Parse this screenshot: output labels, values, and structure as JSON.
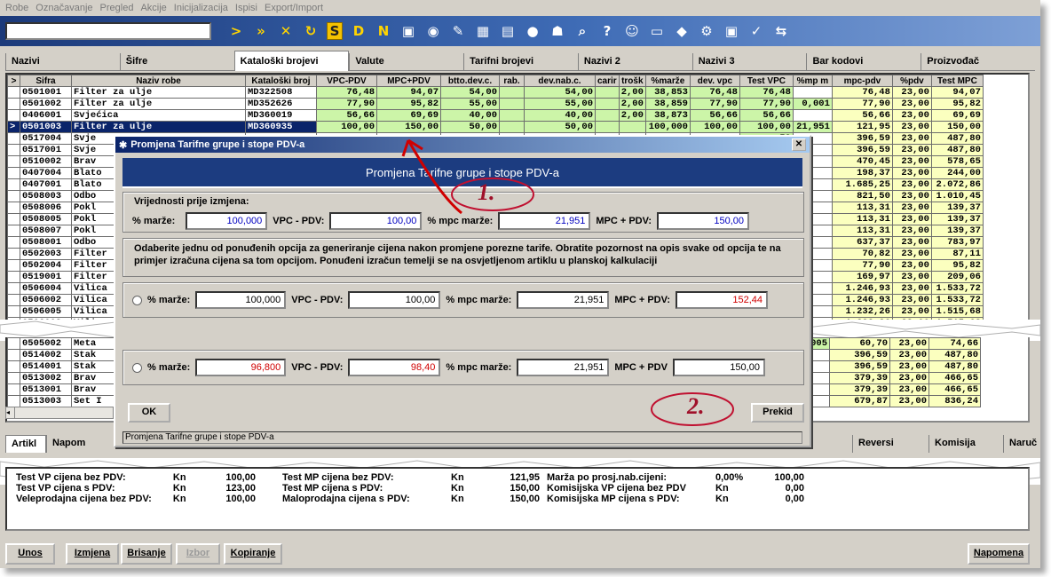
{
  "menu": [
    "Robe",
    "Označavanje",
    "Pregled",
    "Akcije",
    "Inicijalizacija",
    "Ispisi",
    "Export/Import"
  ],
  "toolbar_icons": [
    ">",
    "»",
    "✕",
    "↻",
    "S",
    "D",
    "N",
    "▣",
    "◉",
    "✎",
    "▦",
    "▤",
    "●",
    "☗",
    "⌕",
    "?",
    "☺",
    "▭",
    "◆",
    "⚙",
    "▣",
    "✓",
    "⇆"
  ],
  "tabs": [
    "Nazivi",
    "Šifre",
    "Kataloški brojevi",
    "Valute",
    "Tarifni brojevi",
    "Nazivi 2",
    "Nazivi 3",
    "Bar kodovi",
    "Proizvođač"
  ],
  "grid": {
    "headers": [
      ">",
      "Sifra",
      "Naziv robe",
      "Kataloški broj",
      "VPC-PDV",
      "MPC+PDV",
      "btto.dev.c.",
      "rab.",
      "dev.nab.c.",
      "carir",
      "trošk",
      "%marže",
      "dev. vpc",
      "Test VPC",
      "%mp m",
      "mpc-pdv",
      "%pdv",
      "Test MPC"
    ],
    "rows": [
      [
        "",
        "0501001",
        "Filter za ulje",
        "MD322508",
        "76,48",
        "94,07",
        "54,00",
        "",
        "54,00",
        "",
        "2,00",
        "38,853",
        "76,48",
        "76,48",
        "",
        "76,48",
        "23,00",
        "94,07"
      ],
      [
        "",
        "0501002",
        "Filter za ulje",
        "MD352626",
        "77,90",
        "95,82",
        "55,00",
        "",
        "55,00",
        "",
        "2,00",
        "38,859",
        "77,90",
        "77,90",
        "0,001",
        "77,90",
        "23,00",
        "95,82"
      ],
      [
        "",
        "0406001",
        "Svjećica",
        "MD360019",
        "56,66",
        "69,69",
        "40,00",
        "",
        "40,00",
        "",
        "2,00",
        "38,873",
        "56,66",
        "56,66",
        "",
        "56,66",
        "23,00",
        "69,69"
      ],
      [
        ">",
        "0501003",
        "Filter za ulje",
        "MD360935",
        "100,00",
        "150,00",
        "50,00",
        "",
        "50,00",
        "",
        "",
        "100,000",
        "100,00",
        "100,00",
        "21,951",
        "121,95",
        "23,00",
        "150,00"
      ],
      [
        "",
        "0517004",
        "Svje",
        "",
        "",
        "",
        "",
        "",
        "",
        "",
        "",
        "",
        "",
        "59",
        "",
        "396,59",
        "23,00",
        "487,80"
      ],
      [
        "",
        "0517001",
        "Svje",
        "",
        "",
        "",
        "",
        "",
        "",
        "",
        "",
        "",
        "",
        "59",
        "",
        "396,59",
        "23,00",
        "487,80"
      ],
      [
        "",
        "0510002",
        "Brav",
        "",
        "",
        "",
        "",
        "",
        "",
        "",
        "",
        "",
        "",
        "45",
        "",
        "470,45",
        "23,00",
        "578,65"
      ],
      [
        "",
        "0407004",
        "Blato",
        "",
        "",
        "",
        "",
        "",
        "",
        "",
        "",
        "",
        "",
        "37",
        "",
        "198,37",
        "23,00",
        "244,00"
      ],
      [
        "",
        "0407001",
        "Blato",
        "",
        "",
        "",
        "",
        "",
        "",
        "",
        "",
        "",
        "",
        "25",
        "",
        "1.685,25",
        "23,00",
        "2.072,86"
      ],
      [
        "",
        "0508003",
        "Odbo",
        "",
        "",
        "",
        "",
        "",
        "",
        "",
        "",
        "",
        "",
        "50",
        "",
        "821,50",
        "23,00",
        "1.010,45"
      ],
      [
        "",
        "0508006",
        "Pokl",
        "",
        "",
        "",
        "",
        "",
        "",
        "",
        "",
        "",
        "",
        "31",
        "",
        "113,31",
        "23,00",
        "139,37"
      ],
      [
        "",
        "0508005",
        "Pokl",
        "",
        "",
        "",
        "",
        "",
        "",
        "",
        "",
        "",
        "",
        "31",
        "",
        "113,31",
        "23,00",
        "139,37"
      ],
      [
        "",
        "0508007",
        "Pokl",
        "",
        "",
        "",
        "",
        "",
        "",
        "",
        "",
        "",
        "",
        "31",
        "",
        "113,31",
        "23,00",
        "139,37"
      ],
      [
        "",
        "0508001",
        "Odbo",
        "",
        "",
        "",
        "",
        "",
        "",
        "",
        "",
        "",
        "",
        "37",
        "",
        "637,37",
        "23,00",
        "783,97"
      ],
      [
        "",
        "0502003",
        "Filter",
        "",
        "",
        "",
        "",
        "",
        "",
        "",
        "",
        "",
        "",
        "82",
        "",
        "70,82",
        "23,00",
        "87,11"
      ],
      [
        "",
        "0502004",
        "Filter",
        "",
        "",
        "",
        "",
        "",
        "",
        "",
        "",
        "",
        "",
        "90",
        "",
        "77,90",
        "23,00",
        "95,82"
      ],
      [
        "",
        "0519001",
        "Filter",
        "",
        "",
        "",
        "",
        "",
        "",
        "",
        "",
        "",
        "",
        "97",
        "",
        "169,97",
        "23,00",
        "209,06"
      ],
      [
        "",
        "0506004",
        "Vilica",
        "",
        "",
        "",
        "",
        "",
        "",
        "",
        "",
        "",
        "",
        "93",
        "",
        "1.246,93",
        "23,00",
        "1.533,72"
      ],
      [
        "",
        "0506002",
        "Vilica",
        "",
        "",
        "",
        "",
        "",
        "",
        "",
        "",
        "",
        "",
        "93",
        "",
        "1.246,93",
        "23,00",
        "1.533,72"
      ],
      [
        "",
        "0506005",
        "Vilica",
        "",
        "",
        "",
        "",
        "",
        "",
        "",
        "",
        "",
        "",
        "26",
        "",
        "1.232,26",
        "23,00",
        "1.515,68"
      ],
      [
        "",
        "0506003",
        "Vilica",
        "",
        "",
        "",
        "",
        "",
        "",
        "",
        "",
        "",
        "",
        "26",
        "",
        "1.232,26",
        "23,00",
        "1.515,68"
      ],
      [
        "",
        "0409002",
        "Stak",
        "",
        "",
        "",
        "",
        "",
        "",
        "",
        "",
        "",
        "",
        "59",
        "",
        "396,59",
        "23,00",
        "487,80"
      ]
    ],
    "rows_after": [
      [
        "",
        "0505002",
        "Meta",
        "",
        "",
        "",
        "",
        "",
        "",
        "",
        "",
        "",
        "",
        "70",
        "-0,005",
        "60,70",
        "23,00",
        "74,66"
      ],
      [
        "",
        "0514002",
        "Stak",
        "",
        "",
        "",
        "",
        "",
        "",
        "",
        "",
        "",
        "",
        "59",
        "",
        "396,59",
        "23,00",
        "487,80"
      ],
      [
        "",
        "0514001",
        "Stak",
        "",
        "",
        "",
        "",
        "",
        "",
        "",
        "",
        "",
        "",
        "59",
        "",
        "396,59",
        "23,00",
        "487,80"
      ],
      [
        "",
        "0513002",
        "Brav",
        "",
        "",
        "",
        "",
        "",
        "",
        "",
        "",
        "",
        "",
        "39",
        "",
        "379,39",
        "23,00",
        "466,65"
      ],
      [
        "",
        "0513001",
        "Brav",
        "",
        "",
        "",
        "",
        "",
        "",
        "",
        "",
        "",
        "",
        "39",
        "",
        "379,39",
        "23,00",
        "466,65"
      ],
      [
        "",
        "0513003",
        "Set I",
        "",
        "",
        "",
        "",
        "",
        "",
        "",
        "",
        "",
        "",
        "87",
        "",
        "679,87",
        "23,00",
        "836,24"
      ]
    ]
  },
  "dialog": {
    "title": "Promjena Tarifne grupe i stope PDV-a",
    "banner": "Promjena Tarifne grupe i stope PDV-a",
    "before_label": "Vrijednosti prije izmjena:",
    "lbl_marze": "% marže:",
    "lbl_vpc": "VPC - PDV:",
    "lbl_mpcmarze": "% mpc marže:",
    "lbl_mpc": "MPC + PDV:",
    "before": {
      "marze": "100,000",
      "vpc": "100,00",
      "mpcmarze": "21,951",
      "mpc": "150,00"
    },
    "info": "Odaberite jednu od ponuđenih opcija za generiranje cijena nakon promjene porezne tarife. Obratite pozornost na opis svake od opcija te na primjer izračuna cijena sa tom opcijom. Ponuđeni izračun temelji se na osvjetljenom artiklu u planskoj kalkulaciji",
    "opt1": {
      "marze": "100,000",
      "vpc": "100,00",
      "mpcmarze": "21,951",
      "mpc": "152,44"
    },
    "opt2": {
      "marze": "96,800",
      "vpc": "98,40",
      "mpcmarze": "21,951",
      "mpc": "150,00"
    },
    "lbl_vpc2": "VPC - PDV",
    "lbl_mpc2": "MPC + PDV",
    "ok": "OK",
    "cancel": "Prekid",
    "status": "Promjena Tarifne grupe i stope PDV-a"
  },
  "callouts": [
    "1.",
    "2."
  ],
  "bottom_tabs": [
    "Artikl",
    "Napom",
    "Reversi",
    "Komisija",
    "Naruč"
  ],
  "bottom": {
    "col1": [
      [
        "Test VP cijena bez PDV:",
        "Kn",
        "100,00"
      ],
      [
        "Test VP cijena s PDV:",
        "Kn",
        "123,00"
      ],
      [
        "Veleprodajna cijena bez PDV:",
        "Kn",
        "100,00"
      ]
    ],
    "col2": [
      [
        "Test MP cijena bez PDV:",
        "Kn",
        "121,95"
      ],
      [
        "Test MP cijena s PDV:",
        "Kn",
        "150,00"
      ],
      [
        "Maloprodajna cijena s PDV:",
        "Kn",
        "150,00"
      ]
    ],
    "col3": [
      [
        "Marža po prosj.nab.cijeni:",
        "0,00%",
        "100,00"
      ],
      [
        "Komisijska VP cijena bez PDV",
        "Kn",
        "0,00"
      ],
      [
        "Komisijska MP cijena s PDV:",
        "Kn",
        "0,00"
      ]
    ],
    "partial_top": [
      "Test V. cijena u",
      "Kn",
      "Test MP cijena u valuti",
      "Kn",
      "Kn",
      "0,00"
    ]
  },
  "footer": {
    "buttons": [
      "Unos",
      "Izmjena",
      "Brisanje",
      "Izbor",
      "Kopiranje",
      "Napomena"
    ]
  }
}
